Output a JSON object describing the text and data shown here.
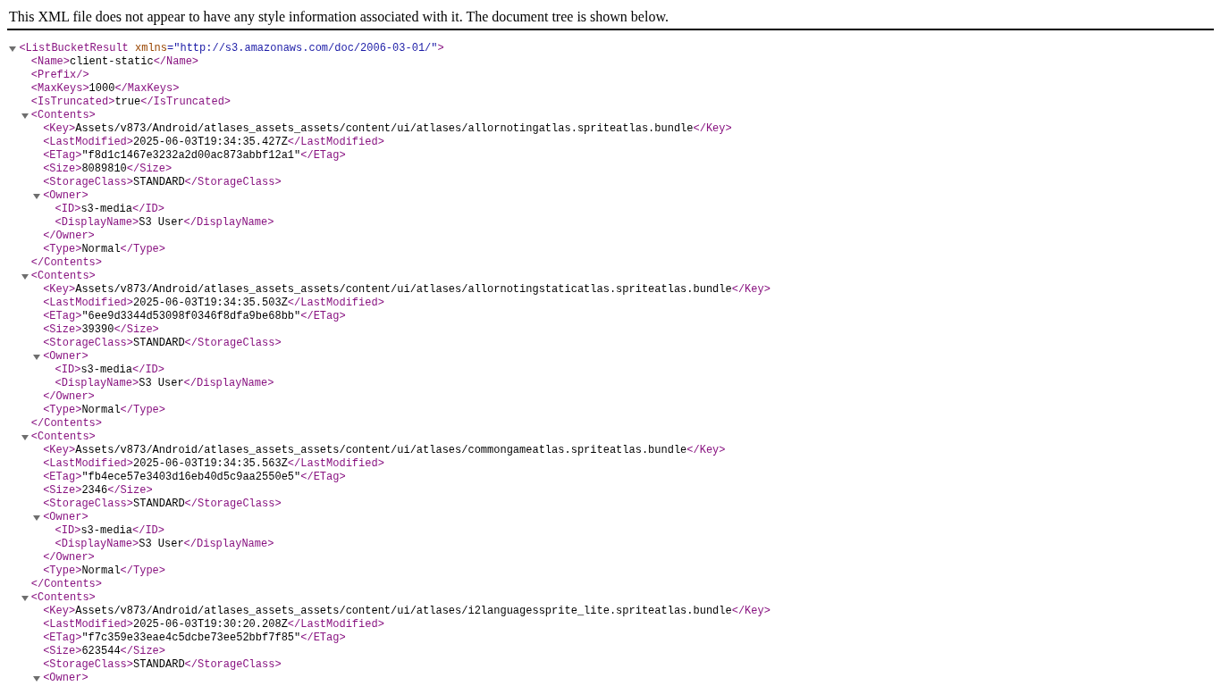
{
  "notice": "This XML file does not appear to have any style information associated with it. The document tree is shown below.",
  "tree": {
    "open_tag": "<ListBucketResult",
    "attributes": [
      {
        "name": "xmlns",
        "value": "=\"http://s3.amazonaws.com/doc/2006-03-01/\""
      }
    ],
    "open_tag_end": ">",
    "expanded": true,
    "children": [
      {
        "open_tag": "<Name>",
        "text": "client-static",
        "close_tag": "</Name>"
      },
      {
        "open_tag": "<Prefix/>"
      },
      {
        "open_tag": "<MaxKeys>",
        "text": "1000",
        "close_tag": "</MaxKeys>"
      },
      {
        "open_tag": "<IsTruncated>",
        "text": "true",
        "close_tag": "</IsTruncated>"
      },
      {
        "open_tag": "<Contents>",
        "close_tag": "</Contents>",
        "expanded": true,
        "children": [
          {
            "open_tag": "<Key>",
            "text": "Assets/v873/Android/atlases_assets_assets/content/ui/atlases/allornotingatlas.spriteatlas.bundle",
            "close_tag": "</Key>"
          },
          {
            "open_tag": "<LastModified>",
            "text": "2025-06-03T19:34:35.427Z",
            "close_tag": "</LastModified>"
          },
          {
            "open_tag": "<ETag>",
            "text": "\"f8d1c1467e3232a2d00ac873abbf12a1\"",
            "close_tag": "</ETag>"
          },
          {
            "open_tag": "<Size>",
            "text": "8089810",
            "close_tag": "</Size>"
          },
          {
            "open_tag": "<StorageClass>",
            "text": "STANDARD",
            "close_tag": "</StorageClass>"
          },
          {
            "open_tag": "<Owner>",
            "close_tag": "</Owner>",
            "expanded": true,
            "children": [
              {
                "open_tag": "<ID>",
                "text": "s3-media",
                "close_tag": "</ID>"
              },
              {
                "open_tag": "<DisplayName>",
                "text": "S3 User",
                "close_tag": "</DisplayName>"
              }
            ]
          },
          {
            "open_tag": "<Type>",
            "text": "Normal",
            "close_tag": "</Type>"
          }
        ]
      },
      {
        "open_tag": "<Contents>",
        "close_tag": "</Contents>",
        "expanded": true,
        "children": [
          {
            "open_tag": "<Key>",
            "text": "Assets/v873/Android/atlases_assets_assets/content/ui/atlases/allornotingstaticatlas.spriteatlas.bundle",
            "close_tag": "</Key>"
          },
          {
            "open_tag": "<LastModified>",
            "text": "2025-06-03T19:34:35.503Z",
            "close_tag": "</LastModified>"
          },
          {
            "open_tag": "<ETag>",
            "text": "\"6ee9d3344d53098f0346f8dfa9be68bb\"",
            "close_tag": "</ETag>"
          },
          {
            "open_tag": "<Size>",
            "text": "39390",
            "close_tag": "</Size>"
          },
          {
            "open_tag": "<StorageClass>",
            "text": "STANDARD",
            "close_tag": "</StorageClass>"
          },
          {
            "open_tag": "<Owner>",
            "close_tag": "</Owner>",
            "expanded": true,
            "children": [
              {
                "open_tag": "<ID>",
                "text": "s3-media",
                "close_tag": "</ID>"
              },
              {
                "open_tag": "<DisplayName>",
                "text": "S3 User",
                "close_tag": "</DisplayName>"
              }
            ]
          },
          {
            "open_tag": "<Type>",
            "text": "Normal",
            "close_tag": "</Type>"
          }
        ]
      },
      {
        "open_tag": "<Contents>",
        "close_tag": "</Contents>",
        "expanded": true,
        "children": [
          {
            "open_tag": "<Key>",
            "text": "Assets/v873/Android/atlases_assets_assets/content/ui/atlases/commongameatlas.spriteatlas.bundle",
            "close_tag": "</Key>"
          },
          {
            "open_tag": "<LastModified>",
            "text": "2025-06-03T19:34:35.563Z",
            "close_tag": "</LastModified>"
          },
          {
            "open_tag": "<ETag>",
            "text": "\"fb4ece57e3403d16eb40d5c9aa2550e5\"",
            "close_tag": "</ETag>"
          },
          {
            "open_tag": "<Size>",
            "text": "2346",
            "close_tag": "</Size>"
          },
          {
            "open_tag": "<StorageClass>",
            "text": "STANDARD",
            "close_tag": "</StorageClass>"
          },
          {
            "open_tag": "<Owner>",
            "close_tag": "</Owner>",
            "expanded": true,
            "children": [
              {
                "open_tag": "<ID>",
                "text": "s3-media",
                "close_tag": "</ID>"
              },
              {
                "open_tag": "<DisplayName>",
                "text": "S3 User",
                "close_tag": "</DisplayName>"
              }
            ]
          },
          {
            "open_tag": "<Type>",
            "text": "Normal",
            "close_tag": "</Type>"
          }
        ]
      },
      {
        "open_tag": "<Contents>",
        "expanded": true,
        "children": [
          {
            "open_tag": "<Key>",
            "text": "Assets/v873/Android/atlases_assets_assets/content/ui/atlases/i2languagessprite_lite.spriteatlas.bundle",
            "close_tag": "</Key>"
          },
          {
            "open_tag": "<LastModified>",
            "text": "2025-06-03T19:30:20.208Z",
            "close_tag": "</LastModified>"
          },
          {
            "open_tag": "<ETag>",
            "text": "\"f7c359e33eae4c5dcbe73ee52bbf7f85\"",
            "close_tag": "</ETag>"
          },
          {
            "open_tag": "<Size>",
            "text": "623544",
            "close_tag": "</Size>"
          },
          {
            "open_tag": "<StorageClass>",
            "text": "STANDARD",
            "close_tag": "</StorageClass>"
          },
          {
            "open_tag": "<Owner>",
            "expanded": true
          }
        ]
      }
    ]
  }
}
